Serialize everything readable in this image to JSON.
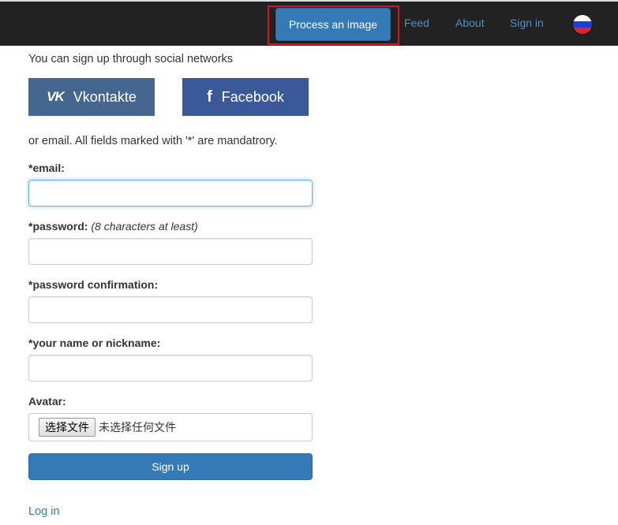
{
  "navbar": {
    "process_label": "Process an image",
    "feed_label": "Feed",
    "about_label": "About",
    "signin_label": "Sign in",
    "language_flag": "russian-flag-icon"
  },
  "social": {
    "intro": "You can sign up through social networks",
    "vk_label": "Vkontakte",
    "vk_icon": "vk-icon",
    "fb_label": "Facebook",
    "fb_icon": "facebook-icon"
  },
  "form": {
    "or_text": "or email. All fields marked with '*' are mandatrory.",
    "email_label": "*email:",
    "email_value": "",
    "password_label": "*password:",
    "password_hint": "(8 characters at least)",
    "password_value": "",
    "confirm_label": "*password confirmation:",
    "confirm_value": "",
    "name_label": "*your name or nickname:",
    "name_value": "",
    "avatar_label": "Avatar:",
    "file_button": "选择文件",
    "file_status": "未选择任何文件",
    "submit_label": "Sign up",
    "login_link": "Log in"
  },
  "colors": {
    "navbar_bg": "#222222",
    "primary": "#337ab7",
    "vk": "#45668e",
    "facebook": "#3b5998",
    "highlight": "#d9121f"
  }
}
